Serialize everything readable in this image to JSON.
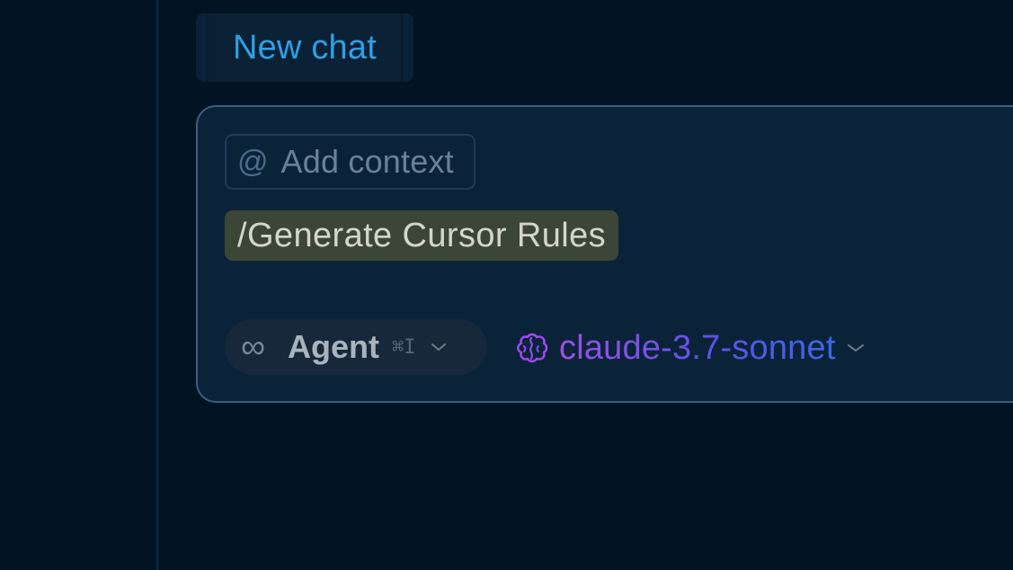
{
  "tab": {
    "label": "New chat"
  },
  "composer": {
    "add_context": {
      "icon": "at-icon",
      "label": "Add context"
    },
    "command": "/Generate Cursor Rules",
    "mode": {
      "icon": "infinity-icon",
      "label": "Agent",
      "shortcut": "⌘I"
    },
    "model": {
      "icon": "brain-icon",
      "label": "claude-3.7-sonnet"
    }
  }
}
